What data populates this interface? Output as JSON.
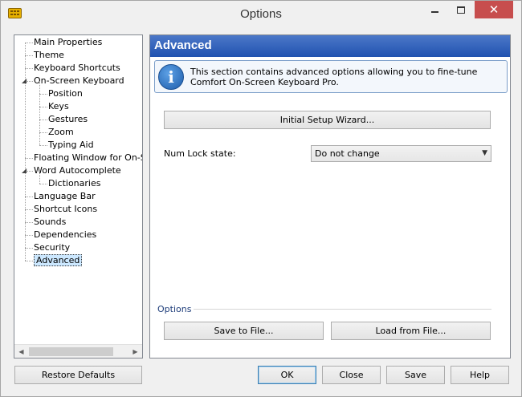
{
  "window": {
    "title": "Options",
    "app_icon": "keyboard-icon",
    "close_glyph": "✕"
  },
  "tree": {
    "items": [
      {
        "label": "Main Properties",
        "level": 0
      },
      {
        "label": "Theme",
        "level": 0
      },
      {
        "label": "Keyboard Shortcuts",
        "level": 0
      },
      {
        "label": "On-Screen Keyboard",
        "level": 0,
        "expander": "◢"
      },
      {
        "label": "Position",
        "level": 1
      },
      {
        "label": "Keys",
        "level": 1
      },
      {
        "label": "Gestures",
        "level": 1
      },
      {
        "label": "Zoom",
        "level": 1
      },
      {
        "label": "Typing Aid",
        "level": 1
      },
      {
        "label": "Floating Window for On-Scre",
        "level": 0
      },
      {
        "label": "Word Autocomplete",
        "level": 0,
        "expander": "◢"
      },
      {
        "label": "Dictionaries",
        "level": 1
      },
      {
        "label": "Language Bar",
        "level": 0
      },
      {
        "label": "Shortcut Icons",
        "level": 0
      },
      {
        "label": "Sounds",
        "level": 0
      },
      {
        "label": "Dependencies",
        "level": 0
      },
      {
        "label": "Security",
        "level": 0
      },
      {
        "label": "Advanced",
        "level": 0,
        "selected": true
      }
    ],
    "scroll_left": "◀",
    "scroll_right": "▶"
  },
  "panel": {
    "title": "Advanced",
    "info_icon_glyph": "i",
    "info_text": "This section contains advanced options allowing you to fine-tune Comfort On-Screen Keyboard Pro.",
    "wizard_button": "Initial Setup Wizard...",
    "numlock_label": "Num Lock state:",
    "numlock_value": "Do not change",
    "numlock_chevron": "▼",
    "options_group": "Options",
    "save_button": "Save to File...",
    "load_button": "Load from File..."
  },
  "footer": {
    "restore_button": "Restore Defaults",
    "ok_button": "OK",
    "close_button": "Close",
    "save_button": "Save",
    "help_button": "Help"
  },
  "colors": {
    "header_blue": "#2a5cb5",
    "close_red": "#c74e4e",
    "selection": "#cce8ff"
  }
}
